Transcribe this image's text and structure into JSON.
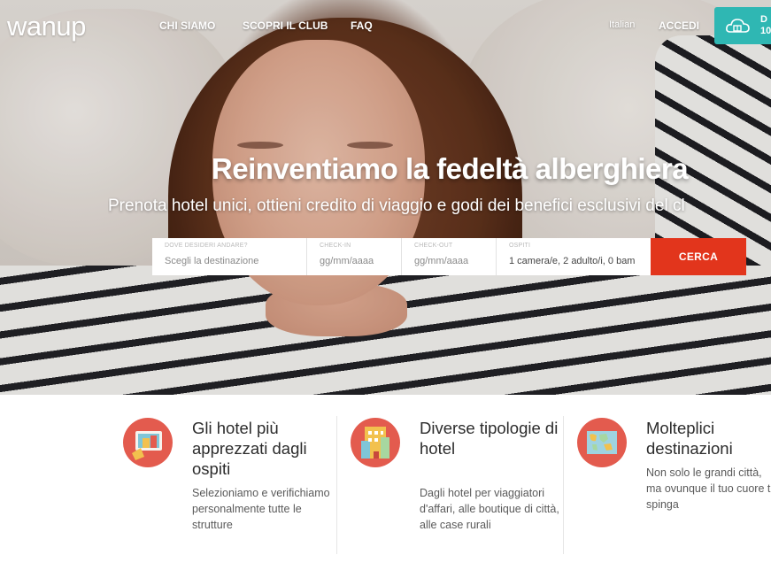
{
  "brand": {
    "logo": "wanup"
  },
  "nav": {
    "links": [
      "CHI SIAMO",
      "SCOPRI IL CLUB",
      "FAQ"
    ],
    "language": "Italian",
    "signin": "ACCEDI",
    "promo_text": [
      "D",
      "10"
    ]
  },
  "hero": {
    "title": "Reinventiamo la fedeltà alberghiera",
    "subtitle": "Prenota hotel unici, ottieni credito di viaggio e godi dei benefici esclusivi del cl"
  },
  "search": {
    "destination": {
      "label": "DOVE DESIDERI ANDARE?",
      "placeholder": "Scegli la destinazione"
    },
    "checkin": {
      "label": "CHECK-IN",
      "placeholder": "gg/mm/aaaa"
    },
    "checkout": {
      "label": "CHECK-OUT",
      "placeholder": "gg/mm/aaaa"
    },
    "guests": {
      "label": "OSPITI",
      "value": "1 camera/e, 2 adulto/i, 0 bam"
    },
    "submit": "CERCA"
  },
  "features": [
    {
      "icon": "tablet-hotel-icon",
      "title": "Gli hotel più apprezzati dagli ospiti",
      "text": "Selezioniamo e verifichiamo personalmente tutte le strutture"
    },
    {
      "icon": "buildings-icon",
      "title": "Diverse tipologie di hotel",
      "text": "Dagli hotel per viaggiatori d'affari, alle boutique di città, alle case rurali"
    },
    {
      "icon": "world-map-icon",
      "title": "Molteplici destinazioni",
      "text": "Non solo le grandi città, ma ovunque il tuo cuore ti spinga"
    }
  ],
  "colors": {
    "accent": "#e2351c",
    "promo": "#2fb7b3",
    "feature_badge": "#e35b4e"
  }
}
